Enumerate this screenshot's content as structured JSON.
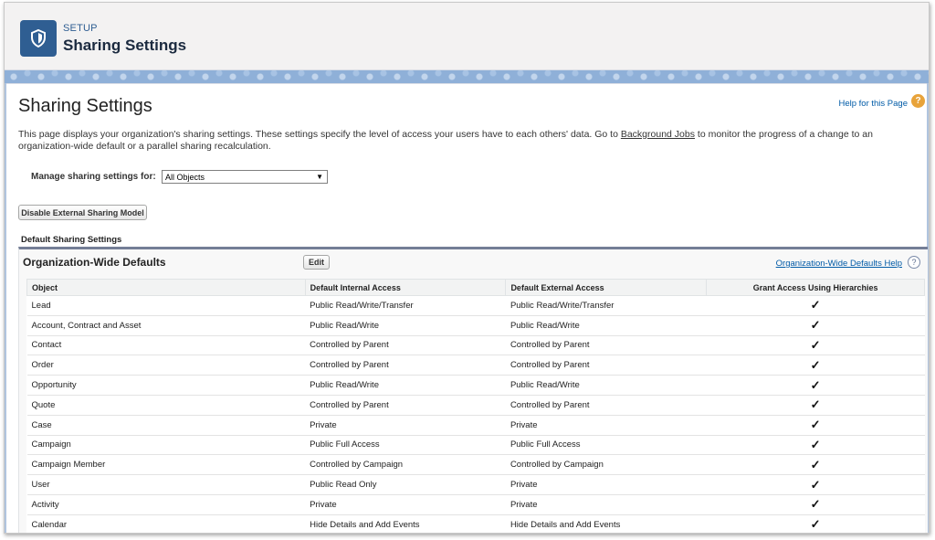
{
  "header": {
    "setup_label": "SETUP",
    "title": "Sharing Settings",
    "icon": "shield-icon"
  },
  "page": {
    "title": "Sharing Settings",
    "help_link": "Help for this Page",
    "help_badge": "?",
    "description_before": "This page displays your organization's sharing settings. These settings specify the level of access your users have to each others' data. Go to ",
    "description_link": "Background Jobs",
    "description_after": " to monitor the progress of a change to an organization-wide default or a parallel sharing recalculation.",
    "manage_label": "Manage sharing settings for:",
    "manage_value": "All Objects",
    "manage_arrow": "▼",
    "disable_button": "Disable External Sharing Model",
    "section_label": "Default Sharing Settings"
  },
  "owd": {
    "title": "Organization-Wide Defaults",
    "edit_button": "Edit",
    "help_link": "Organization-Wide Defaults Help",
    "help_icon": "?",
    "columns": [
      "Object",
      "Default Internal Access",
      "Default External Access",
      "Grant Access Using Hierarchies"
    ],
    "check_glyph": "✓",
    "rows": [
      {
        "object": "Lead",
        "internal": "Public Read/Write/Transfer",
        "external": "Public Read/Write/Transfer",
        "hierarchy": true
      },
      {
        "object": "Account, Contract and Asset",
        "internal": "Public Read/Write",
        "external": "Public Read/Write",
        "hierarchy": true
      },
      {
        "object": "Contact",
        "internal": "Controlled by Parent",
        "external": "Controlled by Parent",
        "hierarchy": true
      },
      {
        "object": "Order",
        "internal": "Controlled by Parent",
        "external": "Controlled by Parent",
        "hierarchy": true
      },
      {
        "object": "Opportunity",
        "internal": "Public Read/Write",
        "external": "Public Read/Write",
        "hierarchy": true
      },
      {
        "object": "Quote",
        "internal": "Controlled by Parent",
        "external": "Controlled by Parent",
        "hierarchy": true
      },
      {
        "object": "Case",
        "internal": "Private",
        "external": "Private",
        "hierarchy": true
      },
      {
        "object": "Campaign",
        "internal": "Public Full Access",
        "external": "Public Full Access",
        "hierarchy": true
      },
      {
        "object": "Campaign Member",
        "internal": "Controlled by Campaign",
        "external": "Controlled by Campaign",
        "hierarchy": true
      },
      {
        "object": "User",
        "internal": "Public Read Only",
        "external": "Private",
        "hierarchy": true
      },
      {
        "object": "Activity",
        "internal": "Private",
        "external": "Private",
        "hierarchy": true
      },
      {
        "object": "Calendar",
        "internal": "Hide Details and Add Events",
        "external": "Hide Details and Add Events",
        "hierarchy": true
      }
    ]
  },
  "colors": {
    "brand": "#2f5e92",
    "link": "#015ba7",
    "help_badge": "#e8a33a",
    "section_border": "#747e96"
  }
}
